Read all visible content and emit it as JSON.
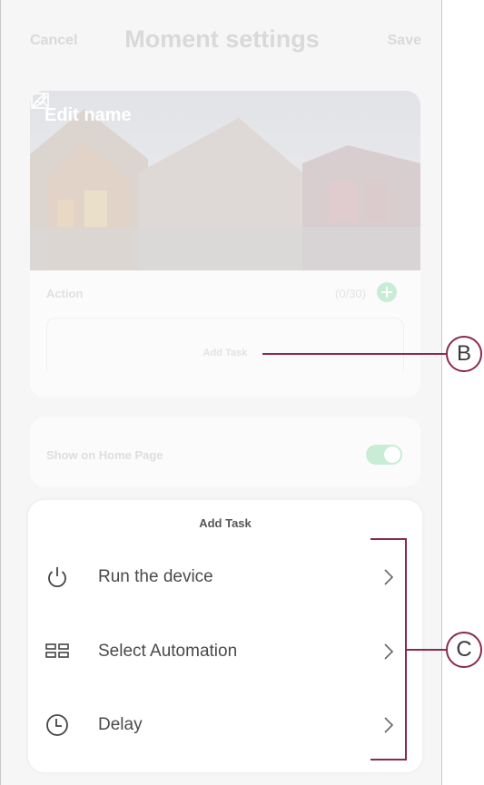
{
  "header": {
    "cancel_label": "Cancel",
    "title": "Moment settings",
    "save_label": "Save"
  },
  "moment_card": {
    "edit_name_label": "Edit name",
    "action_label": "Action",
    "action_count": "(0/30)",
    "add_task_placeholder": "Add Task"
  },
  "home_card": {
    "show_on_home_label": "Show on Home Page",
    "toggle_on": true
  },
  "sheet": {
    "title": "Add Task",
    "items": [
      {
        "label": "Run the device",
        "icon": "power-icon"
      },
      {
        "label": "Select Automation",
        "icon": "automation-grid-icon"
      },
      {
        "label": "Delay",
        "icon": "clock-icon"
      }
    ]
  },
  "callouts": {
    "b": "B",
    "c": "C"
  },
  "colors": {
    "callout": "#8a2b4a",
    "toggle": "#c8ecd5",
    "text_dark": "#4a4a4a"
  }
}
